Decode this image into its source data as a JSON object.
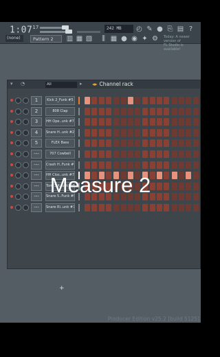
{
  "toolbar": {
    "time_main": "1:07",
    "time_sup": "17",
    "tempo_display": "242 MB",
    "icons": [
      "snap-icon",
      "metronome-icon",
      "record-icon",
      "mic-icon",
      "plugin-icon",
      "browser-icon",
      "mixer-icon",
      "help-icon"
    ]
  },
  "bar2": {
    "mode": "(none)",
    "pattern": "Pattern 2",
    "news_line1": "Today: A newer version of",
    "news_line2": "FL Studio is available!"
  },
  "rack": {
    "filter": "All",
    "title": "Channel rack",
    "add_label": "+",
    "channels": [
      {
        "num": "1",
        "name": "Kick 2_Funk #5",
        "indicator": "orange",
        "steps": [
          1,
          0,
          0,
          0,
          0,
          0,
          1,
          0,
          0,
          0,
          0,
          0,
          0,
          0,
          0,
          0
        ]
      },
      {
        "num": "2",
        "name": "808 Clap",
        "indicator": "gray",
        "steps": [
          0,
          0,
          0,
          0,
          0,
          0,
          0,
          0,
          0,
          0,
          0,
          0,
          0,
          0,
          0,
          0
        ]
      },
      {
        "num": "3",
        "name": "HH Ope..unk #7",
        "indicator": "gray",
        "steps": [
          0,
          0,
          0,
          0,
          0,
          0,
          0,
          0,
          0,
          0,
          0,
          0,
          0,
          0,
          0,
          0
        ]
      },
      {
        "num": "4",
        "name": "Snare H..unk #2",
        "indicator": "gray",
        "steps": [
          0,
          0,
          0,
          0,
          0,
          0,
          0,
          0,
          0,
          0,
          0,
          0,
          0,
          0,
          0,
          0
        ]
      },
      {
        "num": "5",
        "name": "FLEX Bass",
        "indicator": "gray",
        "steps": [
          0,
          0,
          0,
          0,
          0,
          0,
          0,
          0,
          0,
          0,
          0,
          0,
          0,
          0,
          0,
          0
        ]
      },
      {
        "num": "---",
        "name": "707 Cowbell",
        "indicator": "gray",
        "steps": [
          0,
          0,
          0,
          0,
          0,
          0,
          0,
          0,
          0,
          0,
          0,
          0,
          0,
          0,
          0,
          0
        ]
      },
      {
        "num": "---",
        "name": "Crash H..Funk #5",
        "indicator": "gray",
        "steps": [
          0,
          0,
          0,
          0,
          0,
          0,
          0,
          0,
          0,
          0,
          0,
          0,
          0,
          0,
          0,
          0
        ]
      },
      {
        "num": "---",
        "name": "HH Clos..unk #7",
        "indicator": "white",
        "steps": [
          1,
          0,
          1,
          0,
          1,
          0,
          1,
          0,
          1,
          0,
          1,
          0,
          1,
          0,
          1,
          0
        ]
      },
      {
        "num": "---",
        "name": "Tom 3 R..unk #4",
        "indicator": "gray",
        "steps": [
          0,
          0,
          0,
          0,
          0,
          0,
          0,
          0,
          0,
          0,
          0,
          0,
          0,
          0,
          0,
          0
        ]
      },
      {
        "num": "---",
        "name": "Snare 5..Funk #5",
        "indicator": "gray",
        "steps": [
          0,
          0,
          0,
          0,
          0,
          0,
          0,
          0,
          0,
          0,
          0,
          0,
          0,
          0,
          0,
          0
        ]
      },
      {
        "num": "---",
        "name": "Snare Ri..unk #7",
        "indicator": "gray",
        "steps": [
          0,
          0,
          0,
          0,
          0,
          0,
          0,
          0,
          0,
          0,
          0,
          0,
          0,
          0,
          0,
          0
        ]
      }
    ]
  },
  "overlay": "Measure 2",
  "edition": "Producer Edition v25.2 [build 5125]",
  "colors": {
    "step_off": "#8a4033",
    "step_off_alt": "#6e3a31",
    "step_on": "#e6927c",
    "indicator_orange": "#e87d2f",
    "indicator_white": "#f2f2f2",
    "indicator_gray": "#7f8b91",
    "mute_dot": "#d24646"
  }
}
